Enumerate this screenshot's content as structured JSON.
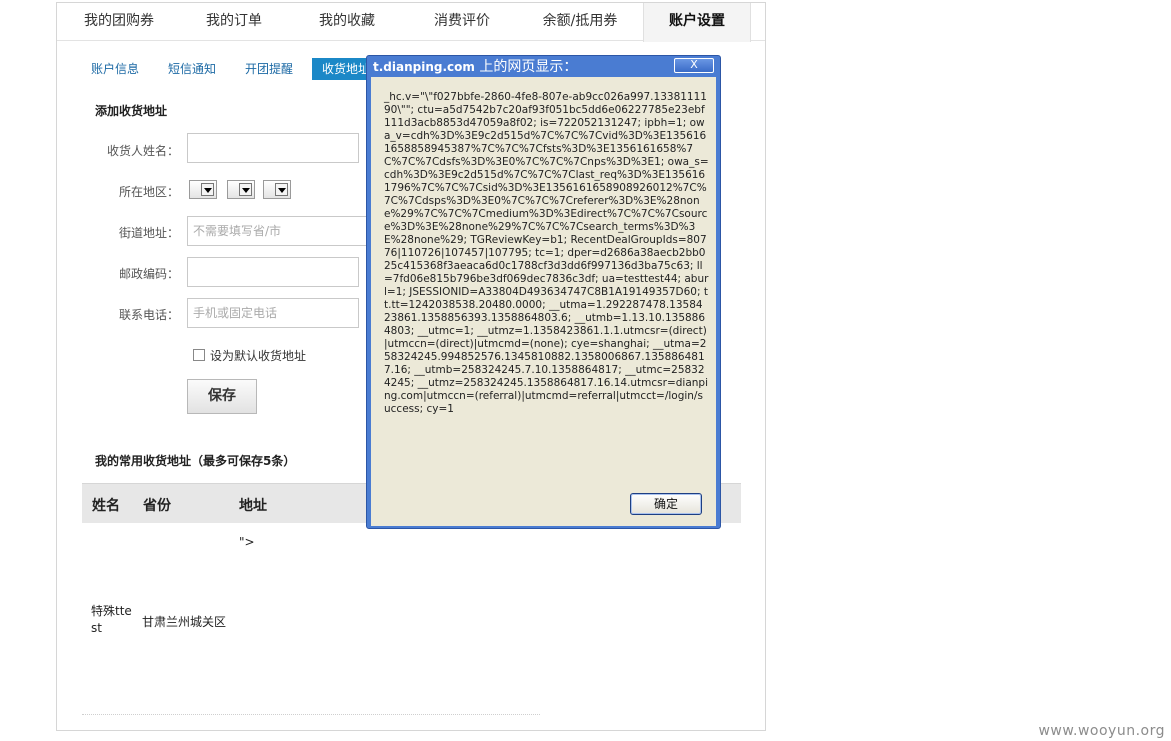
{
  "tabs": [
    {
      "label": "我的团购券"
    },
    {
      "label": "我的订单"
    },
    {
      "label": "我的收藏"
    },
    {
      "label": "消费评价"
    },
    {
      "label": "余额/抵用券"
    },
    {
      "label": "账户设置",
      "active": true
    }
  ],
  "subtabs": [
    {
      "label": "账户信息"
    },
    {
      "label": "短信通知"
    },
    {
      "label": "开团提醒"
    },
    {
      "label": "收货地址",
      "active": true
    }
  ],
  "form": {
    "title": "添加收货地址",
    "name_label": "收货人姓名：",
    "name_value": "",
    "region_label": "所在地区：",
    "street_label": "街道地址：",
    "street_placeholder": "不需要填写省/市",
    "zip_label": "邮政编码：",
    "zip_value": "",
    "phone_label": "联系电话：",
    "phone_placeholder": "手机或固定电话",
    "default_checkbox_label": "设为默认收货地址",
    "default_checked": false,
    "save_label": "保存"
  },
  "addresses": {
    "title": "我的常用收货地址（最多可保存5条）",
    "headers": [
      "姓名",
      "省份",
      "地址"
    ],
    "rows": [
      {
        "name": "",
        "province": "",
        "address": "\">"
      },
      {
        "name": "特殊ttest",
        "province": "甘肃兰州城关区",
        "address": ""
      }
    ]
  },
  "dialog": {
    "title_domain": "t.dianping.com",
    "title_suffix": " 上的网页显示：",
    "close_label": "X",
    "message": "_hc.v=\"\\\"f027bbfe-2860-4fe8-807e-ab9cc026a997.1338111190\\\"\"; ctu=a5d7542b7c20af93f051bc5dd6e06227785e23ebf111d3acb8853d47059a8f02; is=722052131247; ipbh=1; owa_v=cdh%3D%3E9c2d515d%7C%7C%7Cvid%3D%3E1356161658858945387%7C%7C%7Cfsts%3D%3E1356161658%7C%7C%7Cdsfs%3D%3E0%7C%7C%7Cnps%3D%3E1; owa_s=cdh%3D%3E9c2d515d%7C%7C%7Clast_req%3D%3E1356161796%7C%7C%7Csid%3D%3E1356161658908926012%7C%7C%7Cdsps%3D%3E0%7C%7C%7Creferer%3D%3E%28none%29%7C%7C%7Cmedium%3D%3Edirect%7C%7C%7Csource%3D%3E%28none%29%7C%7C%7Csearch_terms%3D%3E%28none%29; TGReviewKey=b1; RecentDealGroupIds=80776|110726|107457|107795; tc=1; dper=d2686a38aecb2bb025c415368f3aeaca6d0c1788cf3d3dd6f997136d3ba75c63; ll=7fd06e815b796be3df069dec7836c3df; ua=testtest44; aburl=1; JSESSIONID=A33804D493634747C8B1A19149357D60; tt.tt=1242038538.20480.0000; __utma=1.292287478.1358423861.1358856393.1358864803.6; __utmb=1.13.10.1358864803; __utmc=1; __utmz=1.1358423861.1.1.utmcsr=(direct)|utmccn=(direct)|utmcmd=(none); cye=shanghai; __utma=258324245.994852576.1345810882.1358006867.1358864817.16; __utmb=258324245.7.10.1358864817; __utmc=258324245; __utmz=258324245.1358864817.16.14.utmcsr=dianping.com|utmccn=(referral)|utmcmd=referral|utmcct=/login/success; cy=1",
    "ok_label": "确定"
  },
  "watermark": "www.wooyun.org"
}
